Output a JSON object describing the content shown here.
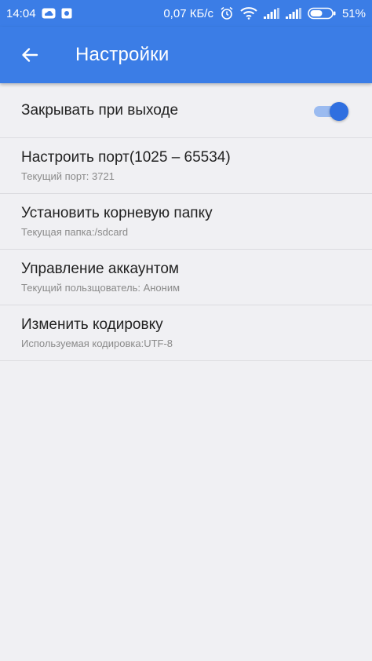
{
  "status_bar": {
    "time": "14:04",
    "network_speed": "0,07 КБ/с",
    "battery_percent": "51%",
    "icons_left": [
      "cloud-icon",
      "app-icon"
    ],
    "icons_right": [
      "alarm-icon",
      "wifi-icon",
      "signal-icon",
      "signal-icon",
      "battery-icon"
    ]
  },
  "app_bar": {
    "title": "Настройки",
    "back_icon": "arrow-left-icon"
  },
  "settings": {
    "items": [
      {
        "title": "Закрывать при выходе",
        "subtitle": "",
        "toggle_on": true
      },
      {
        "title": "Настроить порт(1025 – 65534)",
        "subtitle": "Текущий порт: 3721"
      },
      {
        "title": "Установить корневую папку",
        "subtitle": "Текущая папка:/sdcard"
      },
      {
        "title": "Управление аккаунтом",
        "subtitle": "Текущий пользщователь: Аноним"
      },
      {
        "title": "Изменить кодировку",
        "subtitle": "Используемая кодировка:UTF-8"
      }
    ]
  },
  "colors": {
    "primary": "#3b7de6",
    "toggle_thumb": "#2f6fe0",
    "background": "#f0f0f3"
  }
}
